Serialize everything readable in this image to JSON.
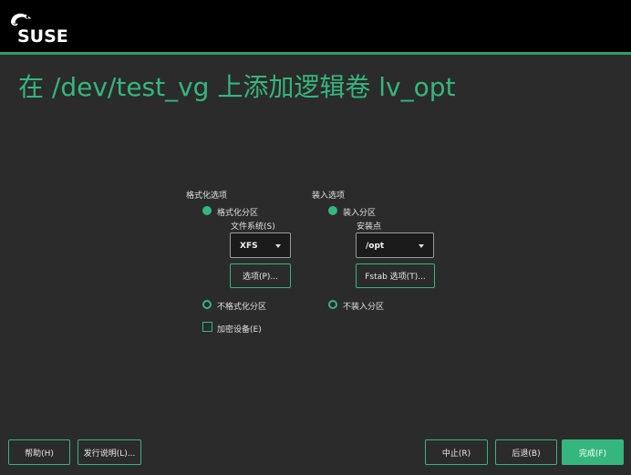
{
  "header": {
    "brand": "SUSE",
    "logo_icon": "chameleon-icon",
    "accent_color": "#35b67e"
  },
  "page": {
    "title": "在 /dev/test_vg 上添加逻辑卷 lv_opt"
  },
  "format_options": {
    "section_label": "格式化选项",
    "format_radio": {
      "label": "格式化分区",
      "selected": true
    },
    "filesystem_label": "文件系统(S)",
    "filesystem_value": "XFS",
    "options_button": "选项(P)...",
    "no_format_radio": {
      "label": "不格式化分区",
      "selected": false
    },
    "encrypt_checkbox": {
      "label": "加密设备(E)",
      "checked": false
    }
  },
  "mount_options": {
    "section_label": "装入选项",
    "mount_radio": {
      "label": "装入分区",
      "selected": true
    },
    "mount_point_label": "安装点",
    "mount_point_value": "/opt",
    "fstab_button": "Fstab 选项(T)...",
    "no_mount_radio": {
      "label": "不装入分区",
      "selected": false
    }
  },
  "footer": {
    "help_button": "帮助(H)",
    "release_notes_button": "发行说明(L)...",
    "abort_button": "中止(R)",
    "back_button": "后退(B)",
    "finish_button": "完成(F)"
  }
}
